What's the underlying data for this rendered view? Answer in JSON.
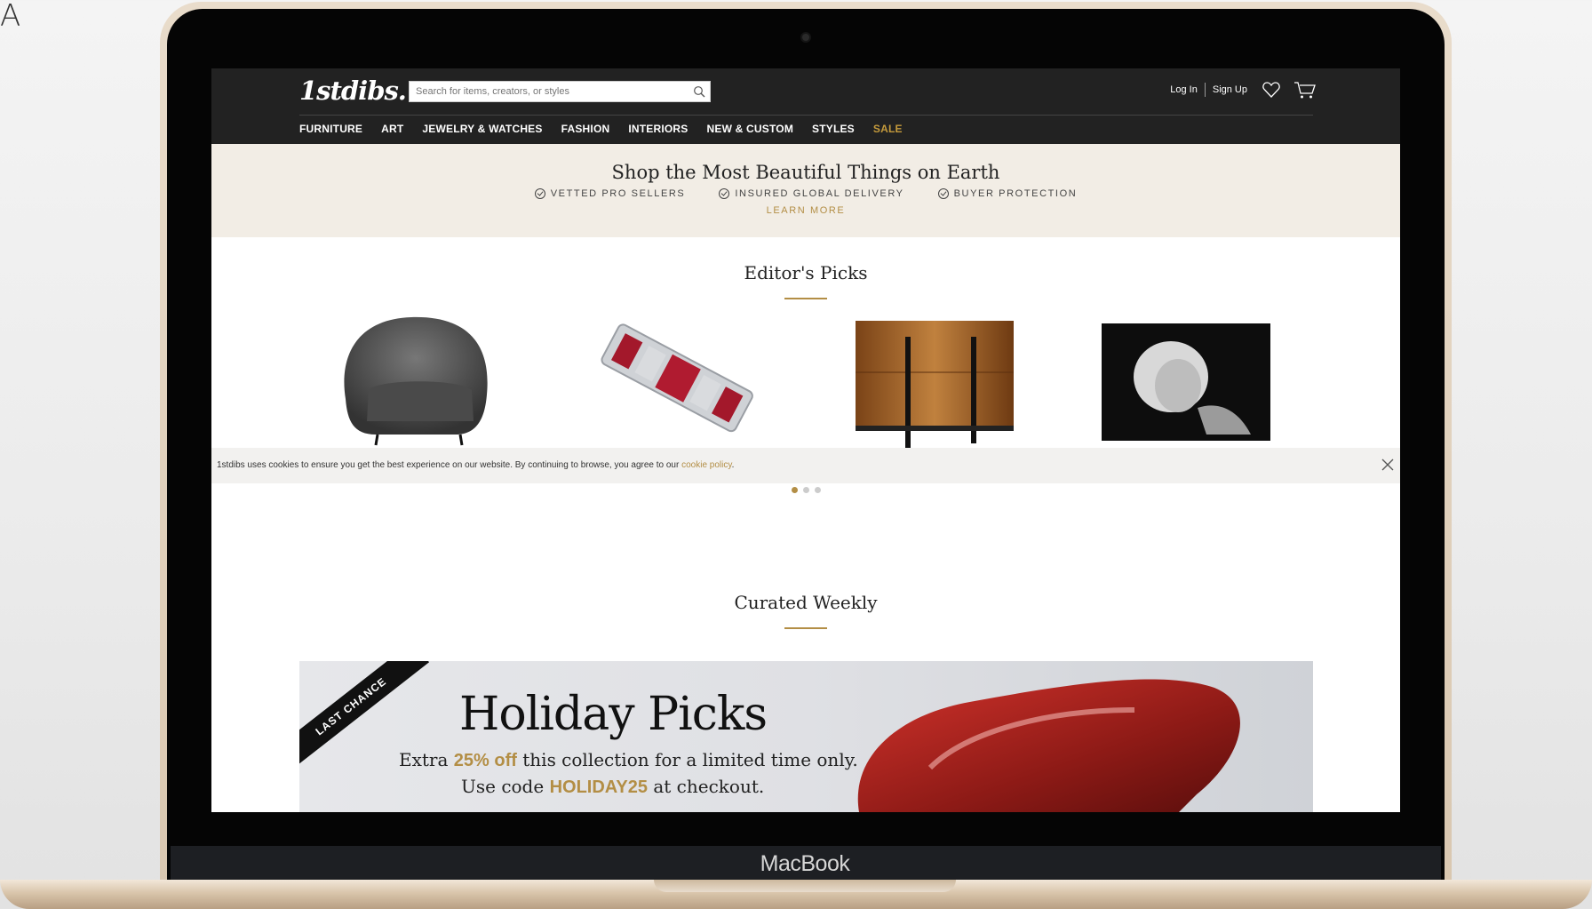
{
  "corner_label": "A",
  "device": {
    "brand": "MacBook"
  },
  "site": {
    "logo": "1stdibs.",
    "search": {
      "placeholder": "Search for items, creators, or styles"
    },
    "header": {
      "login": "Log In",
      "signup": "Sign Up"
    },
    "nav": [
      "FURNITURE",
      "ART",
      "JEWELRY & WATCHES",
      "FASHION",
      "INTERIORS",
      "NEW & CUSTOM",
      "STYLES",
      "SALE"
    ]
  },
  "banner": {
    "title": "Shop the Most Beautiful Things on Earth",
    "features": [
      "VETTED PRO SELLERS",
      "INSURED GLOBAL DELIVERY",
      "BUYER PROTECTION"
    ],
    "learn_more": "LEARN MORE"
  },
  "editors_picks": {
    "title": "Editor's Picks",
    "items": [
      {
        "name": "grey-armchair"
      },
      {
        "name": "ruby-diamond-bracelet"
      },
      {
        "name": "wood-chest"
      },
      {
        "name": "black-white-photograph"
      }
    ],
    "carousel_dots": 3,
    "active_dot": 1
  },
  "cookie": {
    "text": "1stdibs uses cookies to ensure you get the best experience on our website. By continuing to browse, you agree to our ",
    "link": "cookie policy",
    "end": "."
  },
  "curated": {
    "title": "Curated Weekly",
    "promo": {
      "ribbon": "LAST CHANCE",
      "title": "Holiday Picks",
      "line1_pre": "Extra ",
      "line1_highlight": "25% off",
      "line1_post": " this collection for a limited time only.",
      "line2_pre": "Use code ",
      "line2_highlight": "HOLIDAY25",
      "line2_post": " at checkout."
    }
  },
  "colors": {
    "header_bg": "#222222",
    "accent_gold": "#b38e45",
    "banner_bg": "#f2ede5"
  }
}
